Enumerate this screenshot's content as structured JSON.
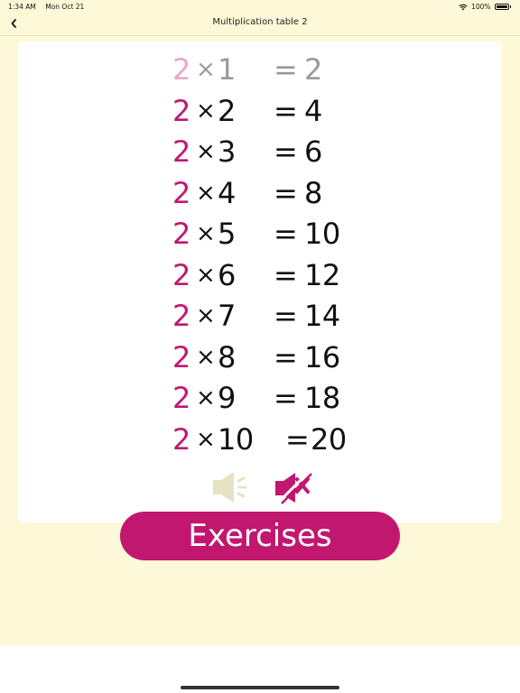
{
  "status_bar": {
    "time": "1:34 AM",
    "date": "Mon Oct 21",
    "battery": "100%"
  },
  "nav": {
    "back_icon": "chevron-left-icon",
    "title": "Multiplication table 2"
  },
  "table": {
    "rows": [
      {
        "multiplicand": "2",
        "times": "×",
        "multiplier": "1",
        "equals": "=",
        "result": "2"
      },
      {
        "multiplicand": "2",
        "times": "×",
        "multiplier": "2",
        "equals": "=",
        "result": "4"
      },
      {
        "multiplicand": "2",
        "times": "×",
        "multiplier": "3",
        "equals": "=",
        "result": "6"
      },
      {
        "multiplicand": "2",
        "times": "×",
        "multiplier": "4",
        "equals": "=",
        "result": "8"
      },
      {
        "multiplicand": "2",
        "times": "×",
        "multiplier": "5",
        "equals": "=",
        "result": "10"
      },
      {
        "multiplicand": "2",
        "times": "×",
        "multiplier": "6",
        "equals": "=",
        "result": "12"
      },
      {
        "multiplicand": "2",
        "times": "×",
        "multiplier": "7",
        "equals": "=",
        "result": "14"
      },
      {
        "multiplicand": "2",
        "times": "×",
        "multiplier": "8",
        "equals": "=",
        "result": "16"
      },
      {
        "multiplicand": "2",
        "times": "×",
        "multiplier": "9",
        "equals": "=",
        "result": "18"
      },
      {
        "multiplicand": "2",
        "times": "×",
        "multiplier": "10",
        "equals": "=",
        "result": "20"
      }
    ]
  },
  "controls": {
    "sound_on_icon": "speaker-on-icon",
    "sound_off_icon": "speaker-muted-icon"
  },
  "exercises_label": "Exercises",
  "colors": {
    "accent": "#c1176f",
    "background": "#fdf9d8",
    "card": "#ffffff",
    "inactive_icon": "#e6e2c4"
  }
}
